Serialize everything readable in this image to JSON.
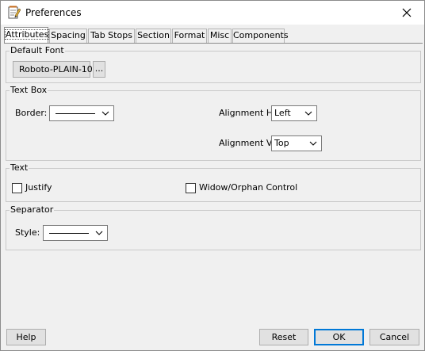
{
  "window": {
    "title": "Preferences",
    "app_icon": "notepad-pencil-icon",
    "close_icon": "close-icon"
  },
  "tabs": [
    {
      "label": "Attributes",
      "active": true
    },
    {
      "label": "Spacing",
      "active": false
    },
    {
      "label": "Tab Stops",
      "active": false
    },
    {
      "label": "Section",
      "active": false
    },
    {
      "label": "Format",
      "active": false
    },
    {
      "label": "Misc",
      "active": false
    },
    {
      "label": "Components",
      "active": false
    }
  ],
  "default_font": {
    "title": "Default Font",
    "font_value": "Roboto-PLAIN-10",
    "browse_label": "..."
  },
  "text_box": {
    "title": "Text Box",
    "border_label": "Border:",
    "alignment_h_label": "Alignment H:",
    "alignment_h_value": "Left",
    "alignment_v_label": "Alignment V:",
    "alignment_v_value": "Top"
  },
  "text": {
    "title": "Text",
    "justify_label": "Justify",
    "justify_checked": false,
    "widow_label": "Widow/Orphan Control",
    "widow_checked": false
  },
  "separator": {
    "title": "Separator",
    "style_label": "Style:"
  },
  "footer": {
    "help_label": "Help",
    "reset_label": "Reset",
    "ok_label": "OK",
    "cancel_label": "Cancel"
  },
  "colors": {
    "focus_border": "#0078d7",
    "background": "#f0f0f0"
  }
}
